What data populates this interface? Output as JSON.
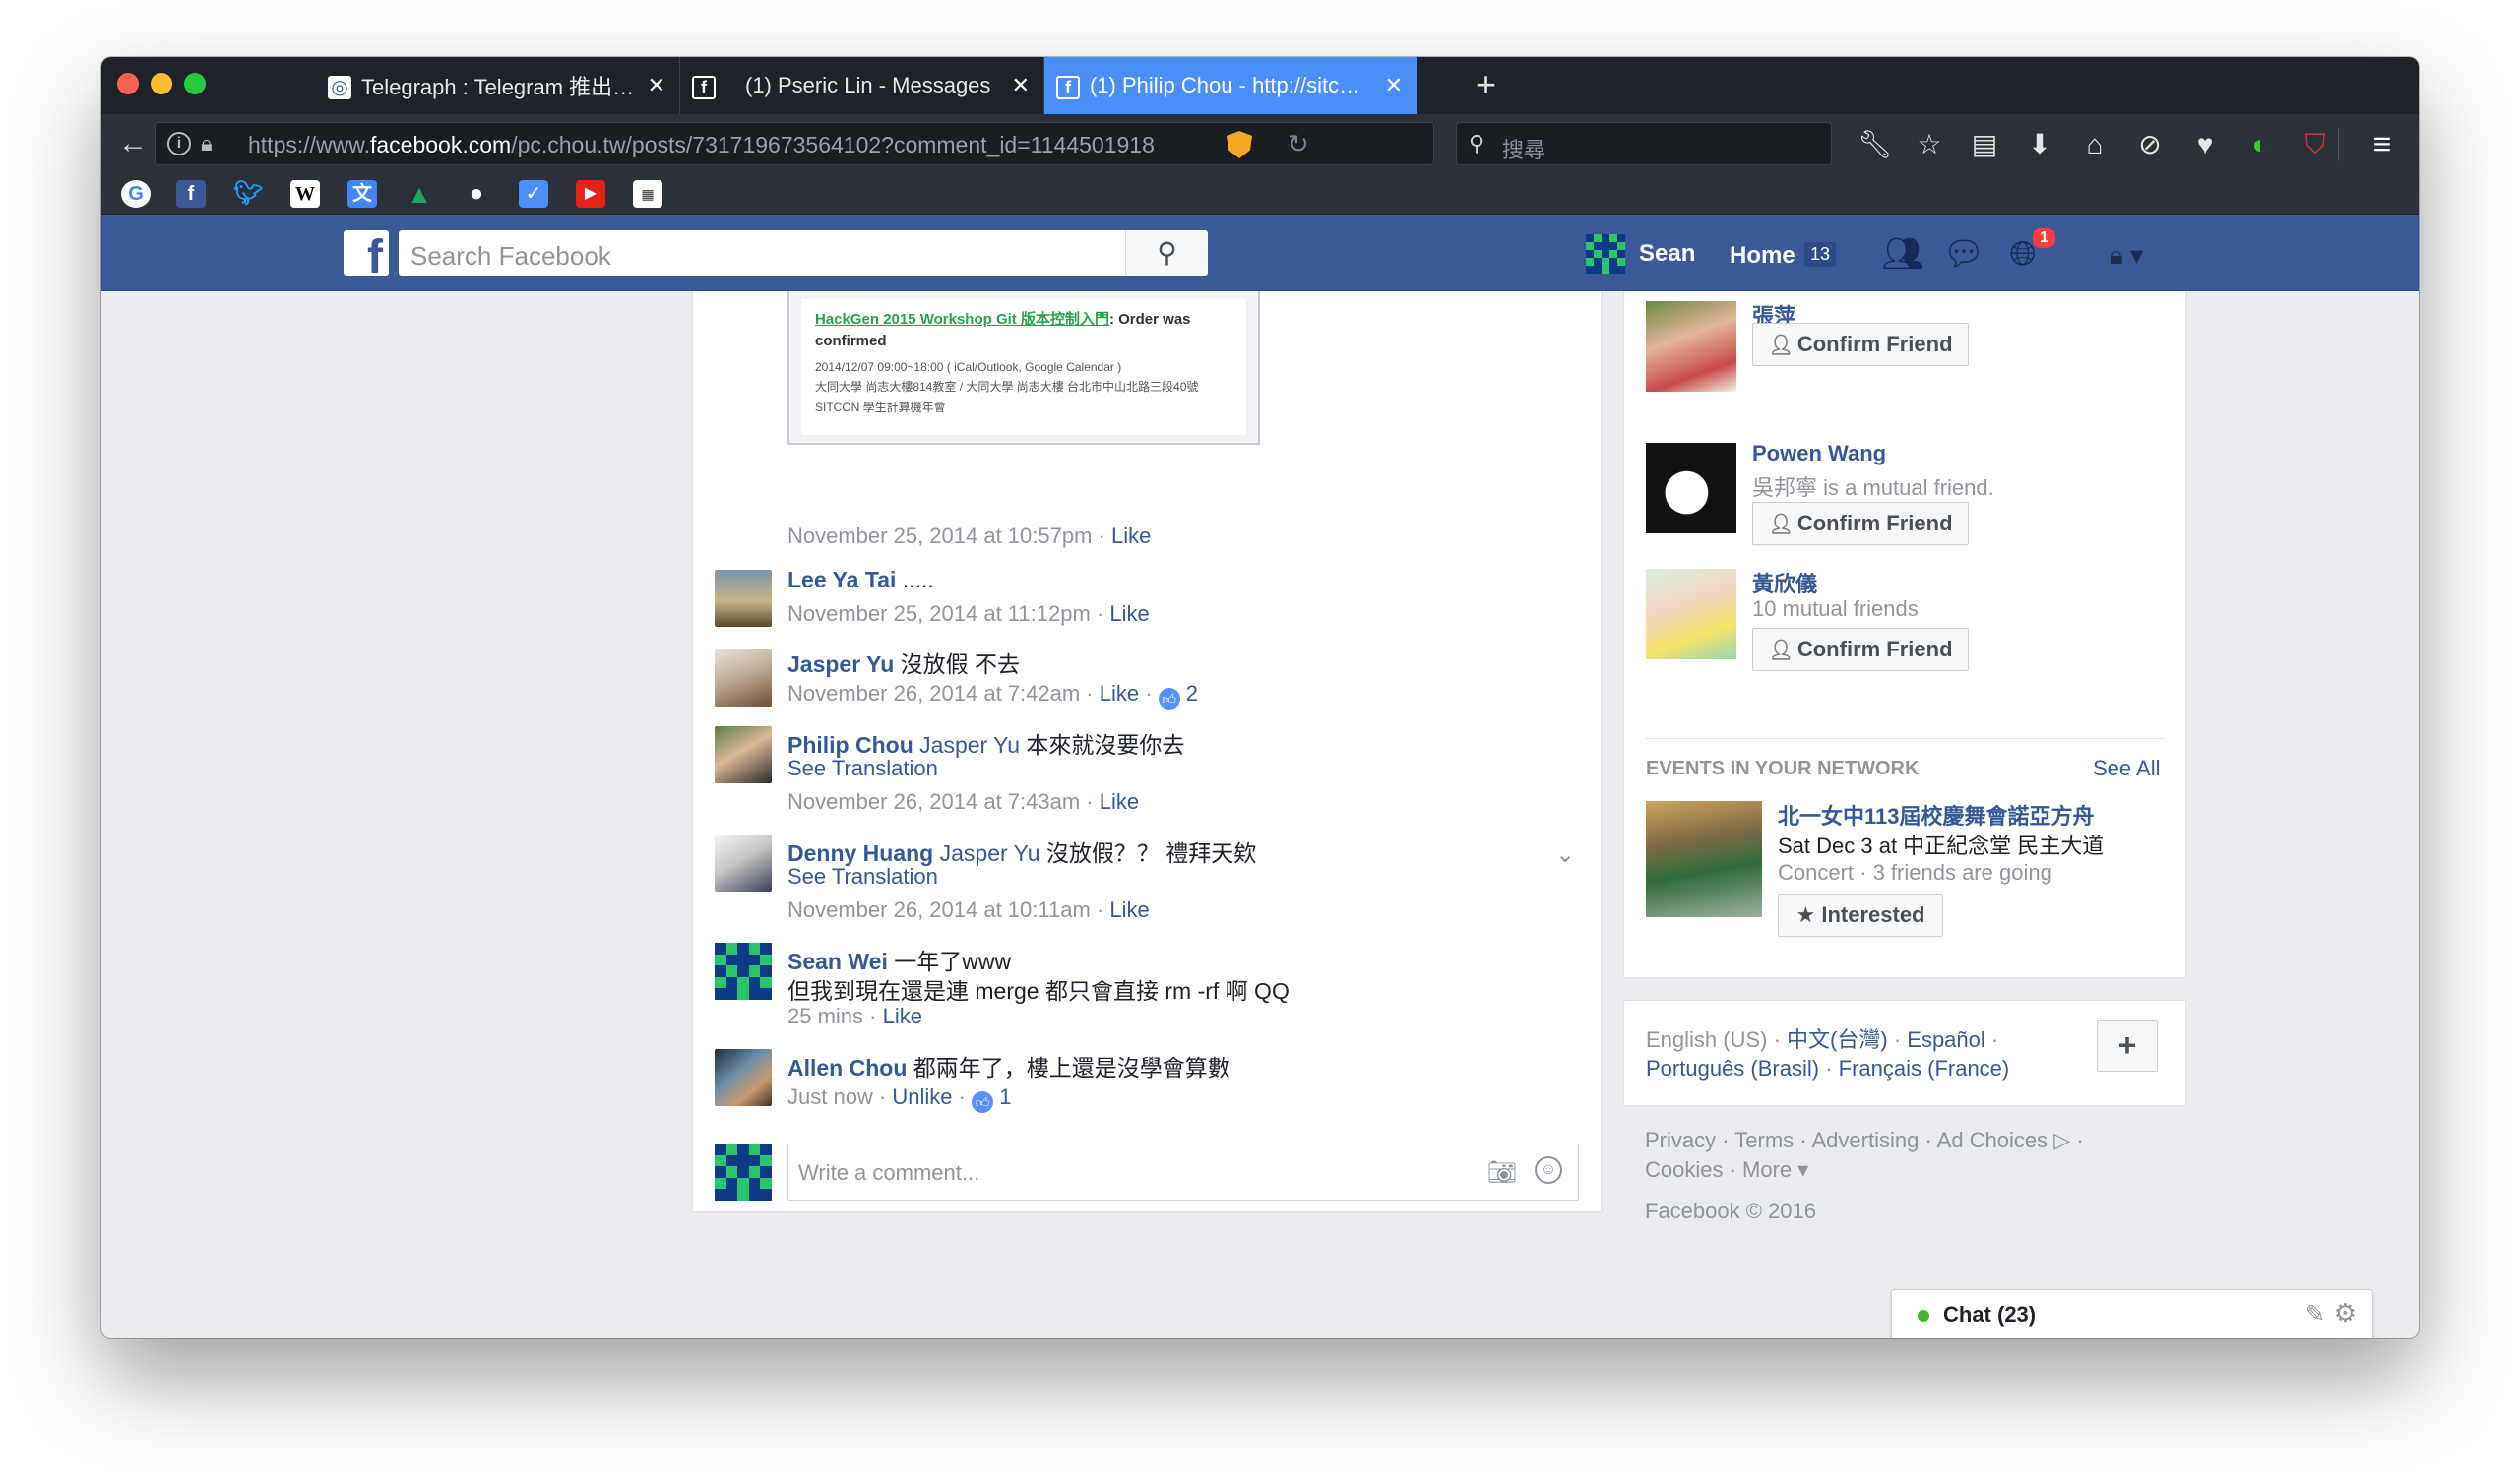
{
  "browser": {
    "tabs": [
      {
        "title": "Telegraph : Telegram 推出…",
        "favicon": "telegraph-icon"
      },
      {
        "title": "(1) Pseric Lin - Messages",
        "favicon": "facebook-icon"
      },
      {
        "title": "(1) Philip Chou - http://sitc…",
        "favicon": "facebook-icon",
        "active": true
      }
    ],
    "url_prefix": "https://www.",
    "url_domain": "facebook.com",
    "url_rest": "/pc.chou.tw/posts/731719673564102?comment_id=1144501918",
    "search_placeholder": "搜尋",
    "accent_tab_color": "#4a8ef7"
  },
  "fb_header": {
    "search_placeholder": "Search Facebook",
    "user_name": "Sean",
    "home_label": "Home",
    "home_count": "13",
    "notifications_count": "1",
    "brand_color": "#3b5998"
  },
  "thread": {
    "embed": {
      "link_text": "HackGen 2015 Workshop Git 版本控制入門",
      "rest_text": ": Order was confirmed",
      "line1": "2014/12/07 09:00~18:00 ( iCal/Outlook, Google Calendar )",
      "line2": "大同大學 尚志大樓814教室 / 大同大學 尚志大樓 台北市中山北路三段40號",
      "line3": "SITCON 學生計算機年會"
    },
    "post_meta": {
      "time": "November 25, 2014 at 10:57pm",
      "like": "Like"
    },
    "comments": [
      {
        "name": "Lee Ya Tai",
        "text": " .....",
        "time": "November 25, 2014 at 11:12pm",
        "action": "Like"
      },
      {
        "name": "Jasper Yu",
        "text": " 沒放假 不去",
        "time": "November 26, 2014 at 7:42am",
        "action": "Like",
        "likes": "2"
      },
      {
        "name": "Philip Chou",
        "mention": " Jasper Yu",
        "text": " 本來就沒要你去",
        "see_translation": "See Translation",
        "time": "November 26, 2014 at 7:43am",
        "action": "Like"
      },
      {
        "name": "Denny Huang",
        "mention": " Jasper Yu",
        "text": " 沒放假？？ 禮拜天欸",
        "see_translation": "See Translation",
        "time": "November 26, 2014 at 10:11am",
        "action": "Like"
      },
      {
        "name": "Sean Wei",
        "text": " 一年了www",
        "text2": "但我到現在還是連 merge 都只會直接 rm -rf 啊 QQ",
        "time": "25 mins",
        "action": "Like"
      },
      {
        "name": "Allen Chou",
        "text": " 都兩年了，樓上還是沒學會算數",
        "time": "Just now",
        "action": "Unlike",
        "likes": "1"
      }
    ],
    "write_placeholder": "Write a comment..."
  },
  "friend_requests": [
    {
      "name": "張萍",
      "sub": "",
      "button": "Confirm Friend"
    },
    {
      "name": "Powen Wang",
      "sub": "吳邦寧 is a mutual friend.",
      "button": "Confirm Friend"
    },
    {
      "name": "黃欣儀",
      "sub": "10 mutual friends",
      "button": "Confirm Friend"
    }
  ],
  "events": {
    "heading": "EVENTS IN YOUR NETWORK",
    "see_all": "See All",
    "title": "北一女中113屆校慶舞會諾亞方舟",
    "date": "Sat Dec 3 at 中正紀念堂 民主大道",
    "sub": "Concert · 3 friends are going",
    "button": "Interested"
  },
  "languages": {
    "current": "English (US)",
    "others": [
      "中文(台灣)",
      "Español",
      "Português (Brasil)",
      "Français (France)"
    ],
    "add": "+"
  },
  "footer": {
    "line1": "Privacy · Terms · Advertising · Ad Choices ▷ ·",
    "line2": "Cookies · More ▾",
    "copyright": "Facebook © 2016"
  },
  "chat": {
    "label": "Chat (23)"
  }
}
